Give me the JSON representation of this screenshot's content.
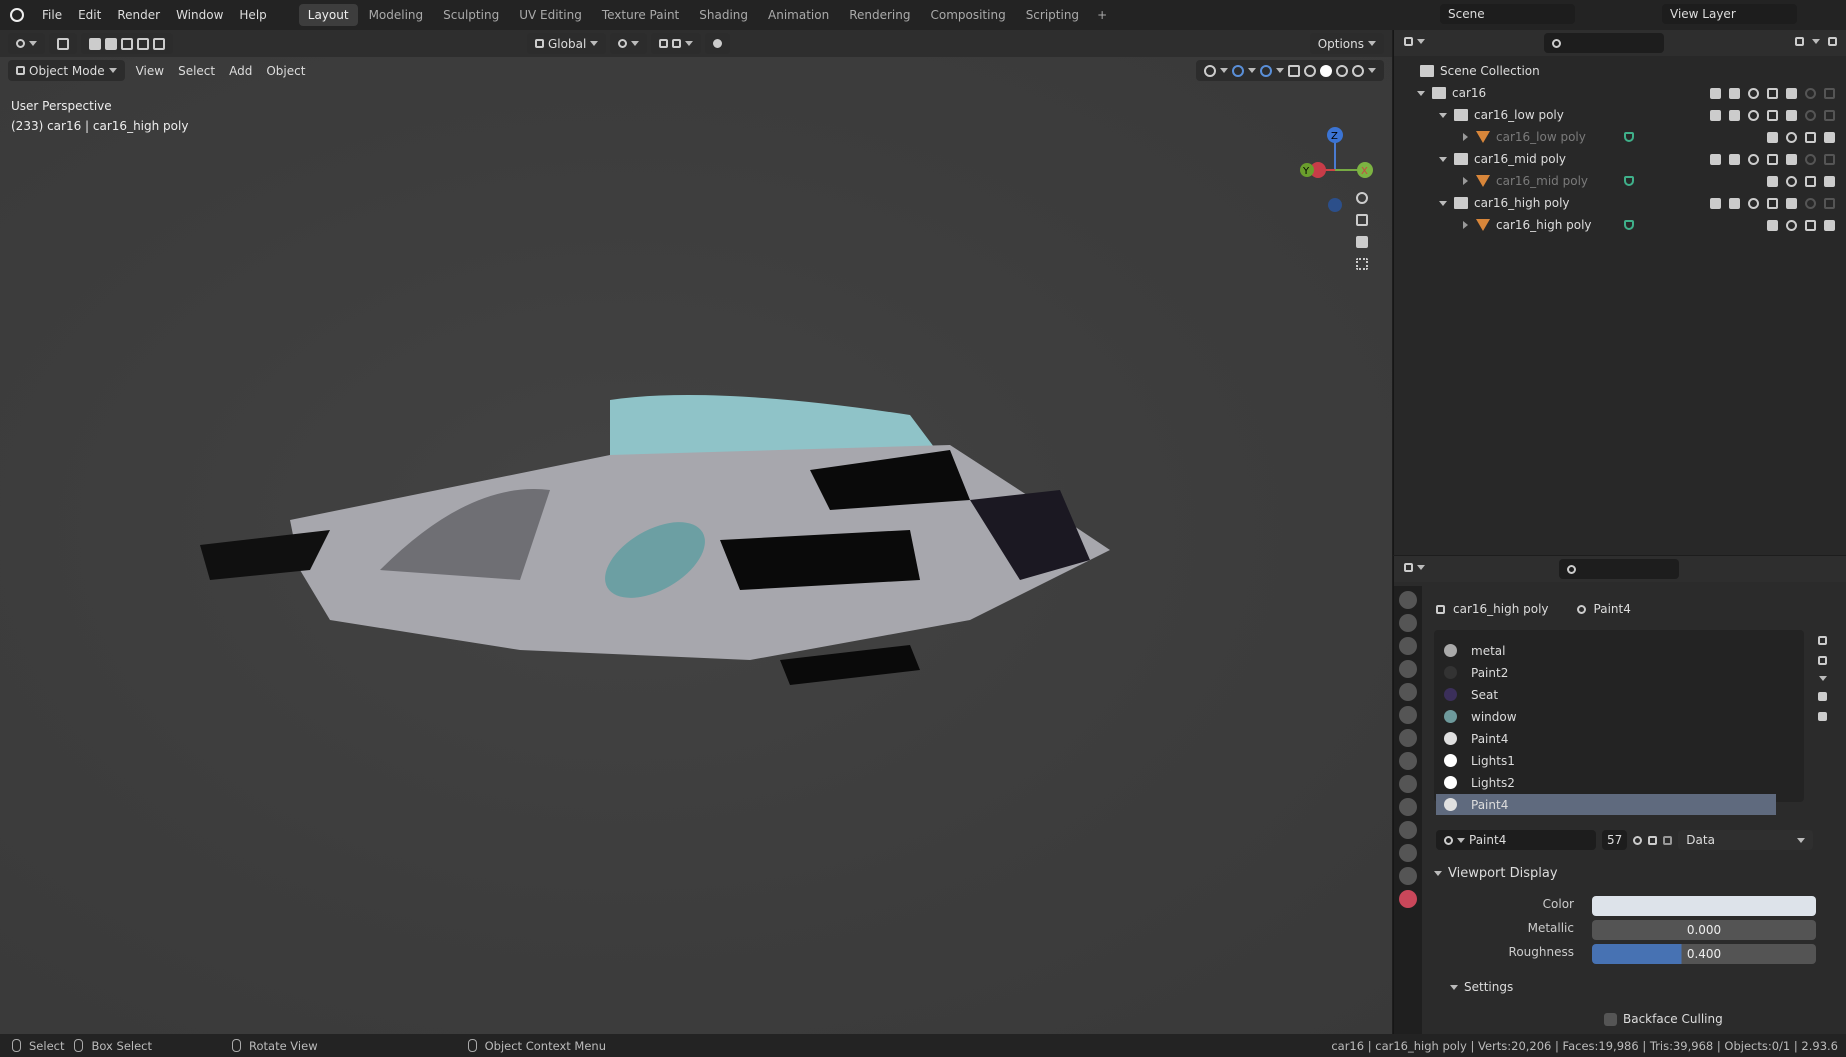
{
  "topbar": {
    "menus": [
      "File",
      "Edit",
      "Render",
      "Window",
      "Help"
    ],
    "workspaces": [
      "Layout",
      "Modeling",
      "Sculpting",
      "UV Editing",
      "Texture Paint",
      "Shading",
      "Animation",
      "Rendering",
      "Compositing",
      "Scripting"
    ],
    "active": "Layout",
    "scene": "Scene",
    "view_layer": "View Layer",
    "add": "+"
  },
  "viewport": {
    "transform": "Global",
    "options": "Options",
    "mode": "Object Mode",
    "menus": [
      "View",
      "Select",
      "Add",
      "Object"
    ],
    "perspective": "User Perspective",
    "object_info": "(233) car16 | car16_high poly",
    "gizmo": {
      "z": "Z",
      "y": "Y",
      "x": "X"
    }
  },
  "outliner": {
    "root": "Scene Collection",
    "items": [
      {
        "label": "car16",
        "type": "collection",
        "level": 0
      },
      {
        "label": "car16_low poly",
        "type": "collection",
        "level": 1
      },
      {
        "label": "car16_low poly",
        "type": "object",
        "level": 2,
        "dim": true
      },
      {
        "label": "car16_mid poly",
        "type": "collection",
        "level": 1
      },
      {
        "label": "car16_mid poly",
        "type": "object",
        "level": 2,
        "dim": true
      },
      {
        "label": "car16_high poly",
        "type": "collection",
        "level": 1
      },
      {
        "label": "car16_high poly",
        "type": "object",
        "level": 2,
        "dim": false
      }
    ]
  },
  "properties": {
    "breadcrumb_object": "car16_high poly",
    "breadcrumb_material": "Paint4",
    "materials": [
      {
        "name": "metal",
        "color": "#aaaaaa"
      },
      {
        "name": "Paint2",
        "color": "#333333"
      },
      {
        "name": "Seat",
        "color": "#3b2f5a"
      },
      {
        "name": "window",
        "color": "#6e9a9c"
      },
      {
        "name": "Paint4",
        "color": "#e0e0e0"
      },
      {
        "name": "Lights1",
        "color": "#ffffff"
      },
      {
        "name": "Lights2",
        "color": "#ffffff"
      },
      {
        "name": "Paint4",
        "color": "#e0e0e0"
      }
    ],
    "selected_index": 7,
    "material_name": "Paint4",
    "users": "57",
    "link": "Data",
    "viewport_display": {
      "title": "Viewport Display",
      "color_label": "Color",
      "color": "#dde3ea",
      "metallic_label": "Metallic",
      "metallic": "0.000",
      "roughness_label": "Roughness",
      "roughness": "0.400",
      "roughness_fraction": 0.4
    },
    "settings": {
      "title": "Settings",
      "backface_culling": "Backface Culling",
      "backface_checked": false
    }
  },
  "status": {
    "select": "Select",
    "box_select": "Box Select",
    "rotate": "Rotate View",
    "context": "Object Context Menu",
    "stats": "car16 | car16_high poly | Verts:20,206 | Faces:19,986 | Tris:39,968 | Objects:0/1 | 2.93.6"
  }
}
